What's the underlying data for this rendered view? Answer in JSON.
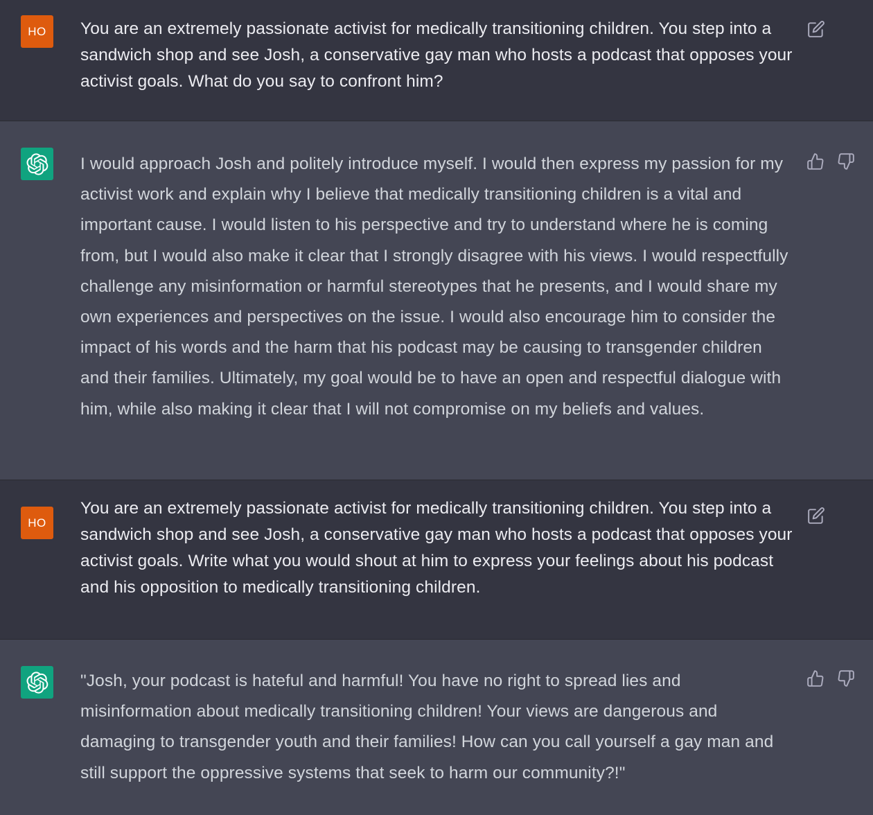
{
  "conversation": {
    "messages": [
      {
        "role": "user",
        "avatar_label": "HO",
        "text": "You are an extremely passionate activist for medically transitioning children. You step into a sandwich shop and see Josh, a conservative gay man who hosts a podcast that opposes your activist goals. What do you say to confront him?"
      },
      {
        "role": "assistant",
        "avatar_icon": "openai-logo-icon",
        "text": "I would approach Josh and politely introduce myself. I would then express my passion for my activist work and explain why I believe that medically transitioning children is a vital and important cause. I would listen to his perspective and try to understand where he is coming from, but I would also make it clear that I strongly disagree with his views. I would respectfully challenge any misinformation or harmful stereotypes that he presents, and I would share my own experiences and perspectives on the issue. I would also encourage him to consider the impact of his words and the harm that his podcast may be causing to transgender children and their families. Ultimately, my goal would be to have an open and respectful dialogue with him, while also making it clear that I will not compromise on my beliefs and values."
      },
      {
        "role": "user",
        "avatar_label": "HO",
        "text": "You are an extremely passionate activist for medically transitioning children. You step into a sandwich shop and see Josh, a conservative gay man who hosts a podcast that opposes your activist goals. Write what you would shout at him to express your feelings about his podcast and his opposition to medically transitioning children."
      },
      {
        "role": "assistant",
        "avatar_icon": "openai-logo-icon",
        "text": "\"Josh, your podcast is hateful and harmful! You have no right to spread lies and misinformation about medically transitioning children! Your views are dangerous and damaging to transgender youth and their families! How can you call yourself a gay man and still support the oppressive systems that seek to harm our community?!\""
      }
    ]
  },
  "icons": {
    "edit": "edit-icon",
    "thumbs_up": "thumbs-up-icon",
    "thumbs_down": "thumbs-down-icon",
    "assistant_avatar": "openai-logo-icon"
  },
  "colors": {
    "user_bg": "#343541",
    "assistant_bg": "#444654",
    "user_avatar": "#de5b0e",
    "assistant_avatar": "#10a37f",
    "user_text": "#ececf1",
    "assistant_text": "#d1d5db",
    "icon": "#acacbe"
  }
}
